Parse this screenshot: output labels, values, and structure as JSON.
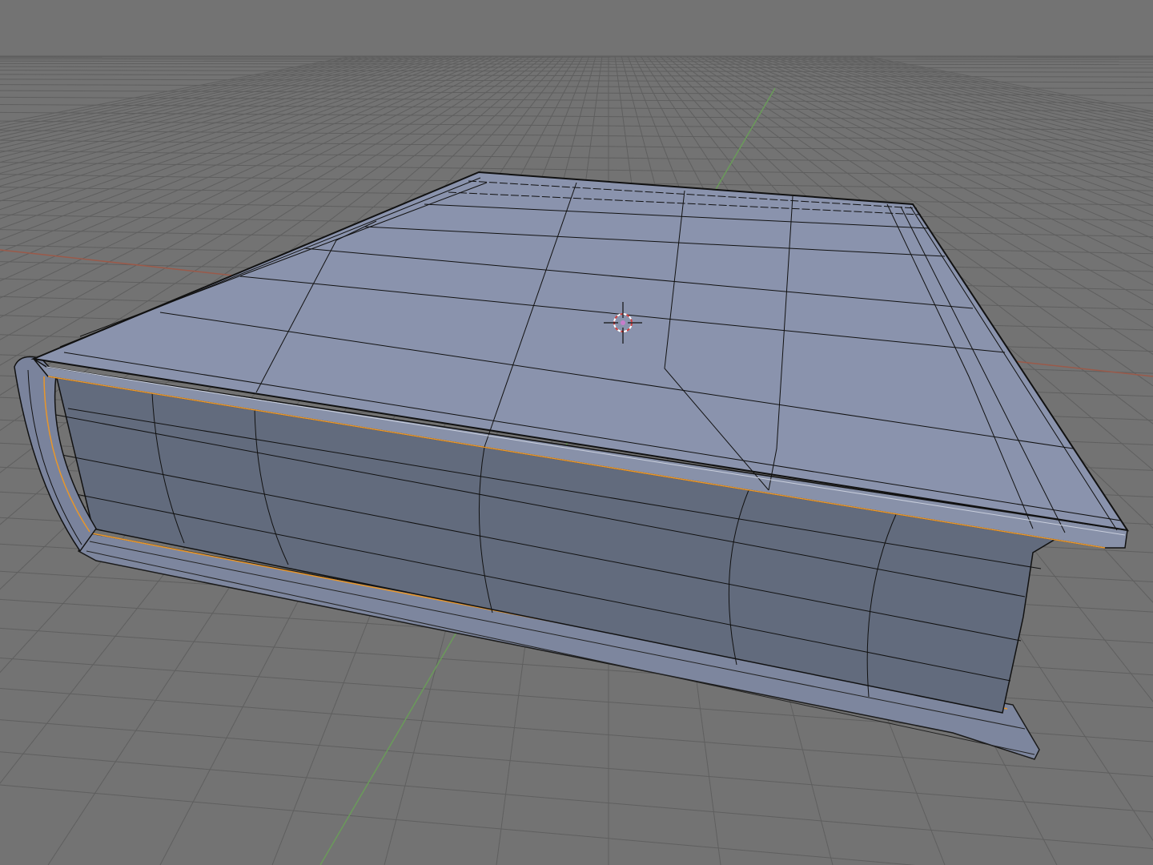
{
  "viewport": {
    "view": "3D Viewport",
    "shading": "solid",
    "mode": "edit",
    "background_color": "#737373",
    "grid_color": "#5f5f5f",
    "x_axis_color": "#9a5a4a",
    "y_axis_color": "#6a9a5a"
  },
  "object": {
    "name_visible": false,
    "shape": "book mesh",
    "face_color_top": "#8a93ad",
    "face_color_pages": "#616a7c",
    "edge_color": "#111111",
    "selected_edge_color": "#e8962a"
  },
  "cursor_3d": {
    "icon": "3d-cursor-icon",
    "ring_color_a": "#d04040",
    "ring_color_b": "#ffffff"
  }
}
